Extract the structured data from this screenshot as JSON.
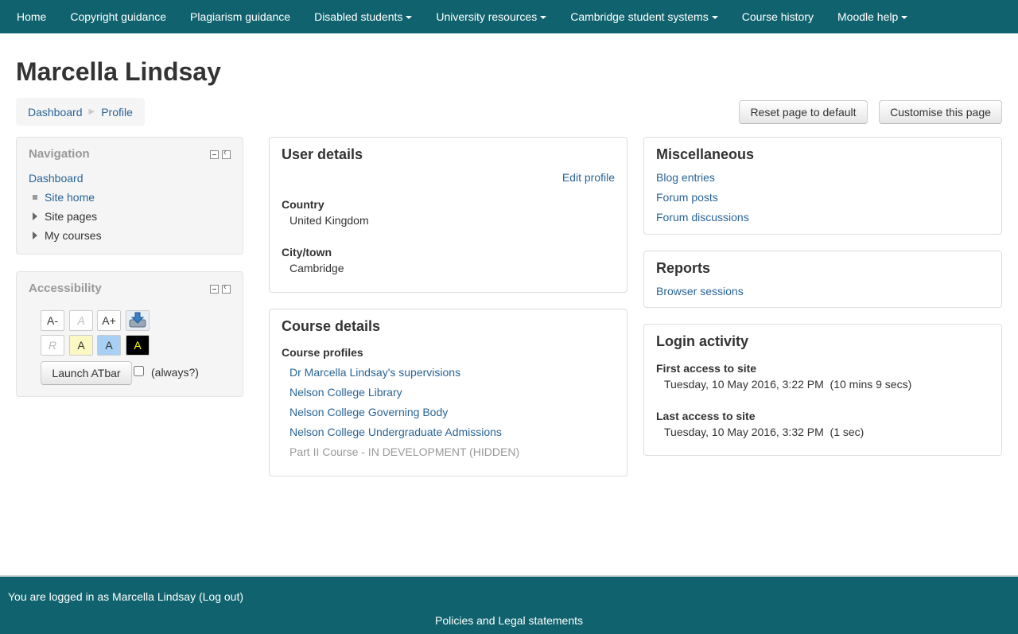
{
  "topnav": {
    "items": [
      {
        "label": "Home"
      },
      {
        "label": "Copyright guidance"
      },
      {
        "label": "Plagiarism guidance"
      },
      {
        "label": "Disabled students"
      },
      {
        "label": "University resources"
      },
      {
        "label": "Cambridge student systems"
      },
      {
        "label": "Course history"
      },
      {
        "label": "Moodle help"
      }
    ]
  },
  "page": {
    "title": "Marcella Lindsay"
  },
  "breadcrumb": {
    "items": [
      "Dashboard",
      "Profile"
    ],
    "separator": "▶"
  },
  "buttons": {
    "reset": "Reset page to default",
    "customise": "Customise this page"
  },
  "navigation": {
    "title": "Navigation",
    "items": [
      "Dashboard",
      "Site home",
      "Site pages",
      "My courses"
    ]
  },
  "accessibility": {
    "title": "Accessibility",
    "buttons_row1": [
      "A-",
      "A",
      "A+"
    ],
    "buttons_row2": [
      "R",
      "A",
      "A",
      "A"
    ],
    "launch": "Launch ATbar",
    "always": "(always?)"
  },
  "user_details": {
    "title": "User details",
    "edit": "Edit profile",
    "country_label": "Country",
    "country": "United Kingdom",
    "city_label": "City/town",
    "city": "Cambridge"
  },
  "course_details": {
    "title": "Course details",
    "profiles_label": "Course profiles",
    "courses": [
      "Dr Marcella Lindsay's supervisions",
      "Nelson College Library",
      "Nelson College Governing Body",
      "Nelson College Undergraduate Admissions",
      "Part II Course - IN DEVELOPMENT (HIDDEN)"
    ]
  },
  "misc": {
    "title": "Miscellaneous",
    "links": [
      "Blog entries",
      "Forum posts",
      "Forum discussions"
    ]
  },
  "reports": {
    "title": "Reports",
    "links": [
      "Browser sessions"
    ]
  },
  "login": {
    "title": "Login activity",
    "first_label": "First access to site",
    "first": "Tuesday, 10 May 2016, 3:22 PM  (10 mins 9 secs)",
    "last_label": "Last access to site",
    "last": "Tuesday, 10 May 2016, 3:32 PM  (1 sec)"
  },
  "footer": {
    "logged_prefix": "You are logged in as ",
    "user": "Marcella Lindsay",
    "logout": "(Log out)",
    "policies": "Policies and Legal statements"
  },
  "colors": {
    "navbar": "#10636e",
    "link": "#2a6496"
  }
}
